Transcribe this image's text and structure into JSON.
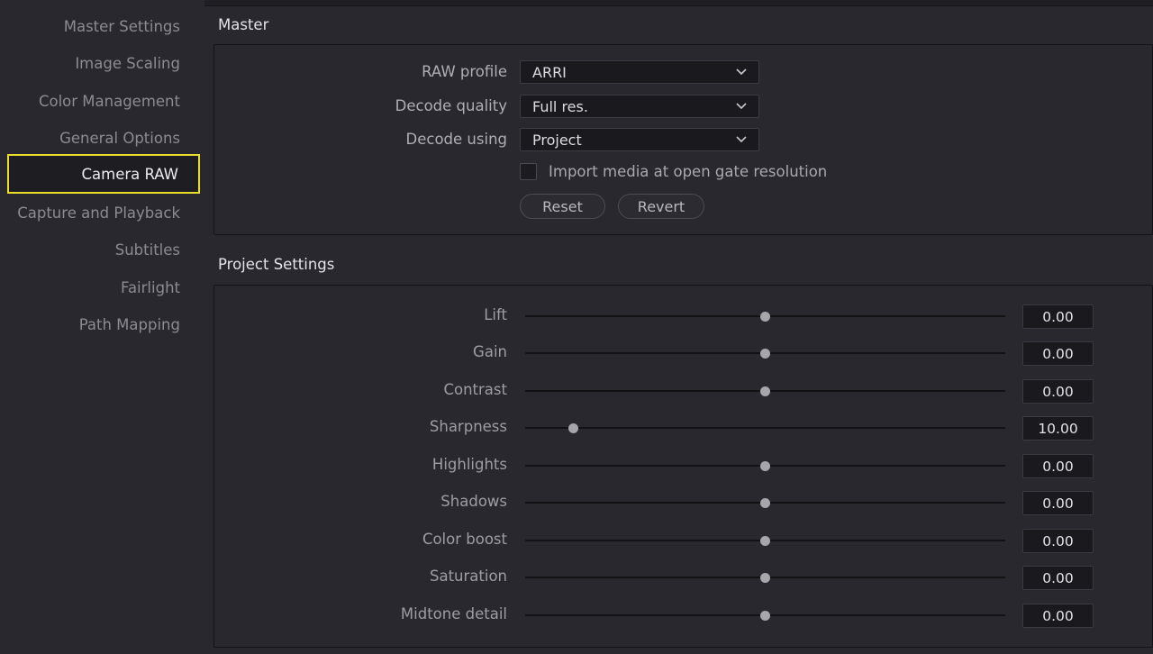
{
  "sidebar": {
    "items": [
      {
        "label": "Master Settings"
      },
      {
        "label": "Image Scaling"
      },
      {
        "label": "Color Management"
      },
      {
        "label": "General Options"
      },
      {
        "label": "Camera RAW",
        "active": true
      },
      {
        "label": "Capture and Playback"
      },
      {
        "label": "Subtitles"
      },
      {
        "label": "Fairlight"
      },
      {
        "label": "Path Mapping"
      }
    ]
  },
  "master": {
    "title": "Master",
    "raw_profile": {
      "label": "RAW profile",
      "value": "ARRI"
    },
    "decode_quality": {
      "label": "Decode quality",
      "value": "Full res."
    },
    "decode_using": {
      "label": "Decode using",
      "value": "Project"
    },
    "open_gate": {
      "label": "Import media at open gate resolution",
      "checked": false
    },
    "reset_label": "Reset",
    "revert_label": "Revert"
  },
  "project_settings": {
    "title": "Project Settings",
    "sliders": [
      {
        "label": "Lift",
        "value": "0.00",
        "position": 0.5
      },
      {
        "label": "Gain",
        "value": "0.00",
        "position": 0.5
      },
      {
        "label": "Contrast",
        "value": "0.00",
        "position": 0.5
      },
      {
        "label": "Sharpness",
        "value": "10.00",
        "position": 0.1
      },
      {
        "label": "Highlights",
        "value": "0.00",
        "position": 0.5
      },
      {
        "label": "Shadows",
        "value": "0.00",
        "position": 0.5
      },
      {
        "label": "Color boost",
        "value": "0.00",
        "position": 0.5
      },
      {
        "label": "Saturation",
        "value": "0.00",
        "position": 0.5
      },
      {
        "label": "Midtone detail",
        "value": "0.00",
        "position": 0.5
      }
    ]
  },
  "colors": {
    "active_highlight": "#e9de2b",
    "background": "#28282e",
    "field_background": "#1a1a1e"
  }
}
